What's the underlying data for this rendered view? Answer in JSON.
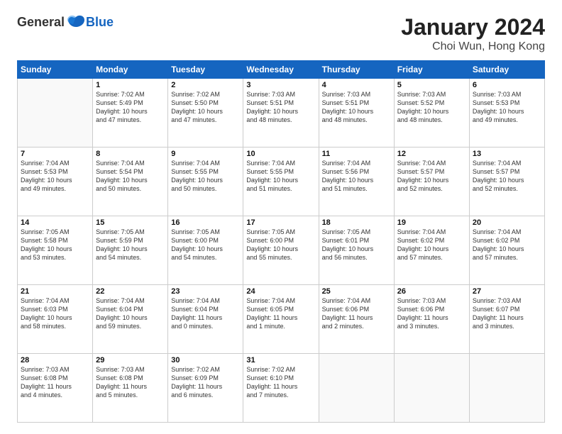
{
  "logo": {
    "general": "General",
    "blue": "Blue"
  },
  "title": "January 2024",
  "subtitle": "Choi Wun, Hong Kong",
  "days_of_week": [
    "Sunday",
    "Monday",
    "Tuesday",
    "Wednesday",
    "Thursday",
    "Friday",
    "Saturday"
  ],
  "weeks": [
    [
      {
        "day": "",
        "info": ""
      },
      {
        "day": "1",
        "info": "Sunrise: 7:02 AM\nSunset: 5:49 PM\nDaylight: 10 hours\nand 47 minutes."
      },
      {
        "day": "2",
        "info": "Sunrise: 7:02 AM\nSunset: 5:50 PM\nDaylight: 10 hours\nand 47 minutes."
      },
      {
        "day": "3",
        "info": "Sunrise: 7:03 AM\nSunset: 5:51 PM\nDaylight: 10 hours\nand 48 minutes."
      },
      {
        "day": "4",
        "info": "Sunrise: 7:03 AM\nSunset: 5:51 PM\nDaylight: 10 hours\nand 48 minutes."
      },
      {
        "day": "5",
        "info": "Sunrise: 7:03 AM\nSunset: 5:52 PM\nDaylight: 10 hours\nand 48 minutes."
      },
      {
        "day": "6",
        "info": "Sunrise: 7:03 AM\nSunset: 5:53 PM\nDaylight: 10 hours\nand 49 minutes."
      }
    ],
    [
      {
        "day": "7",
        "info": "Sunrise: 7:04 AM\nSunset: 5:53 PM\nDaylight: 10 hours\nand 49 minutes."
      },
      {
        "day": "8",
        "info": "Sunrise: 7:04 AM\nSunset: 5:54 PM\nDaylight: 10 hours\nand 50 minutes."
      },
      {
        "day": "9",
        "info": "Sunrise: 7:04 AM\nSunset: 5:55 PM\nDaylight: 10 hours\nand 50 minutes."
      },
      {
        "day": "10",
        "info": "Sunrise: 7:04 AM\nSunset: 5:55 PM\nDaylight: 10 hours\nand 51 minutes."
      },
      {
        "day": "11",
        "info": "Sunrise: 7:04 AM\nSunset: 5:56 PM\nDaylight: 10 hours\nand 51 minutes."
      },
      {
        "day": "12",
        "info": "Sunrise: 7:04 AM\nSunset: 5:57 PM\nDaylight: 10 hours\nand 52 minutes."
      },
      {
        "day": "13",
        "info": "Sunrise: 7:04 AM\nSunset: 5:57 PM\nDaylight: 10 hours\nand 52 minutes."
      }
    ],
    [
      {
        "day": "14",
        "info": "Sunrise: 7:05 AM\nSunset: 5:58 PM\nDaylight: 10 hours\nand 53 minutes."
      },
      {
        "day": "15",
        "info": "Sunrise: 7:05 AM\nSunset: 5:59 PM\nDaylight: 10 hours\nand 54 minutes."
      },
      {
        "day": "16",
        "info": "Sunrise: 7:05 AM\nSunset: 6:00 PM\nDaylight: 10 hours\nand 54 minutes."
      },
      {
        "day": "17",
        "info": "Sunrise: 7:05 AM\nSunset: 6:00 PM\nDaylight: 10 hours\nand 55 minutes."
      },
      {
        "day": "18",
        "info": "Sunrise: 7:05 AM\nSunset: 6:01 PM\nDaylight: 10 hours\nand 56 minutes."
      },
      {
        "day": "19",
        "info": "Sunrise: 7:04 AM\nSunset: 6:02 PM\nDaylight: 10 hours\nand 57 minutes."
      },
      {
        "day": "20",
        "info": "Sunrise: 7:04 AM\nSunset: 6:02 PM\nDaylight: 10 hours\nand 57 minutes."
      }
    ],
    [
      {
        "day": "21",
        "info": "Sunrise: 7:04 AM\nSunset: 6:03 PM\nDaylight: 10 hours\nand 58 minutes."
      },
      {
        "day": "22",
        "info": "Sunrise: 7:04 AM\nSunset: 6:04 PM\nDaylight: 10 hours\nand 59 minutes."
      },
      {
        "day": "23",
        "info": "Sunrise: 7:04 AM\nSunset: 6:04 PM\nDaylight: 11 hours\nand 0 minutes."
      },
      {
        "day": "24",
        "info": "Sunrise: 7:04 AM\nSunset: 6:05 PM\nDaylight: 11 hours\nand 1 minute."
      },
      {
        "day": "25",
        "info": "Sunrise: 7:04 AM\nSunset: 6:06 PM\nDaylight: 11 hours\nand 2 minutes."
      },
      {
        "day": "26",
        "info": "Sunrise: 7:03 AM\nSunset: 6:06 PM\nDaylight: 11 hours\nand 3 minutes."
      },
      {
        "day": "27",
        "info": "Sunrise: 7:03 AM\nSunset: 6:07 PM\nDaylight: 11 hours\nand 3 minutes."
      }
    ],
    [
      {
        "day": "28",
        "info": "Sunrise: 7:03 AM\nSunset: 6:08 PM\nDaylight: 11 hours\nand 4 minutes."
      },
      {
        "day": "29",
        "info": "Sunrise: 7:03 AM\nSunset: 6:08 PM\nDaylight: 11 hours\nand 5 minutes."
      },
      {
        "day": "30",
        "info": "Sunrise: 7:02 AM\nSunset: 6:09 PM\nDaylight: 11 hours\nand 6 minutes."
      },
      {
        "day": "31",
        "info": "Sunrise: 7:02 AM\nSunset: 6:10 PM\nDaylight: 11 hours\nand 7 minutes."
      },
      {
        "day": "",
        "info": ""
      },
      {
        "day": "",
        "info": ""
      },
      {
        "day": "",
        "info": ""
      }
    ]
  ]
}
